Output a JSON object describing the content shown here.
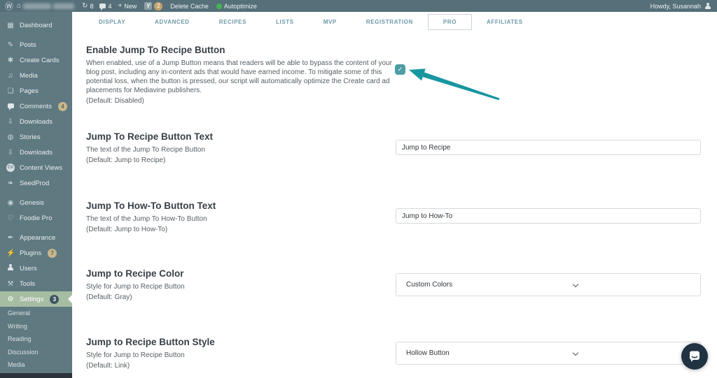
{
  "colors": {
    "accent_teal": "#17969f",
    "admin_bar_bg": "#56707a",
    "sidebar_bg": "#5f7981",
    "active_item_bg": "#a7bda3",
    "tab_text": "#6d98a6",
    "checkbox_teal": "#4d9da5",
    "intercom_bg": "#213343",
    "autoptimize_green": "#46b450"
  },
  "admin_bar": {
    "wp_glyph": "Ⓦ",
    "home_glyph": "⌂",
    "updates_glyph": "↻",
    "updates_count": "8",
    "comments_count": "4",
    "plus_glyph": "+",
    "new_label": "New",
    "yoast_glyph": "Y",
    "yoast_badge_count": "2",
    "delete_cache_label": "Delete Cache",
    "autoptimize_label": "Autoptimize",
    "howdy_text": "Howdy, Susannah"
  },
  "tabs": {
    "items": [
      "DISPLAY",
      "ADVANCED",
      "RECIPES",
      "LISTS",
      "MVP",
      "REGISTRATION",
      "PRO",
      "AFFILIATES"
    ],
    "active": "PRO"
  },
  "sidebar": {
    "items": [
      {
        "label": "Dashboard",
        "glyph": "▦"
      },
      {
        "label": "Posts",
        "glyph": "✎"
      },
      {
        "label": "Create Cards",
        "glyph": "✱"
      },
      {
        "label": "Media",
        "glyph": "♫"
      },
      {
        "label": "Pages",
        "glyph": "❏"
      },
      {
        "label": "Comments",
        "badge": "4"
      },
      {
        "label": "Downloads",
        "glyph": "⇩"
      },
      {
        "label": "Stories",
        "glyph": "◍"
      },
      {
        "label": "Downloads",
        "glyph": "⇩"
      },
      {
        "label": "Content Views",
        "glyph": "CV"
      },
      {
        "label": "SeedProd",
        "glyph": "❧"
      },
      {
        "label": "Genesis",
        "glyph": "◉"
      },
      {
        "label": "Foodie Pro",
        "glyph": "♡"
      },
      {
        "label": "Appearance",
        "glyph": "✒"
      },
      {
        "label": "Plugins",
        "glyph": "⚡",
        "badge": "7"
      },
      {
        "label": "Users"
      },
      {
        "label": "Tools",
        "glyph": "⚒"
      },
      {
        "label": "Settings",
        "glyph": "⚙",
        "badge": "3",
        "active": true
      }
    ],
    "submenu": [
      "General",
      "Writing",
      "Reading",
      "Discussion",
      "Media"
    ]
  },
  "sections": [
    {
      "title": "Enable Jump To Recipe Button",
      "description": "When enabled, use of a Jump Button means that readers will be able to bypass the content of your blog post, including any in-content ads that would have earned income. To mitigate some of this potential loss, when the button is pressed, our script will automatically optimize the Create card ad placements for Mediavine publishers.",
      "default": "(Default: Disabled)",
      "control": "checkbox",
      "checked": true
    },
    {
      "title": "Jump To Recipe Button Text",
      "description": "The text of the Jump To Recipe Button",
      "default": "(Default: Jump to Recipe)",
      "control": "text",
      "value": "Jump to Recipe"
    },
    {
      "title": "Jump To How-To Button Text",
      "description": "The text of the Jump To How-To Button",
      "default": "(Default: Jump to How-To)",
      "control": "text",
      "value": "Jump to How-To"
    },
    {
      "title": "Jump to Recipe Color",
      "description": "Style for Jump to Recipe Button",
      "default": "(Default: Gray)",
      "control": "select",
      "value": "Custom Colors"
    },
    {
      "title": "Jump to Recipe Button Style",
      "description": "Style for Jump to Recipe Button",
      "default": "(Default: Link)",
      "control": "select",
      "value": "Hollow Button"
    }
  ]
}
